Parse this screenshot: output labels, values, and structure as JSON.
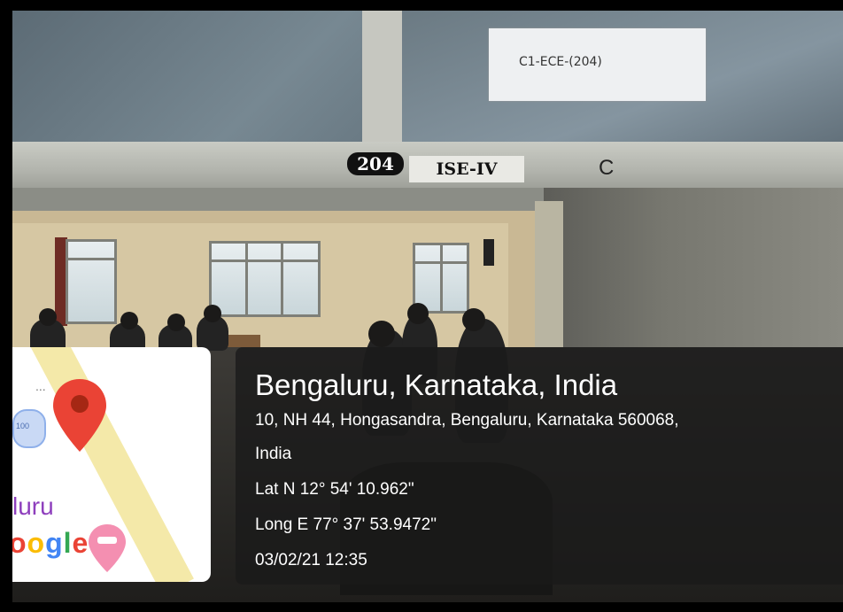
{
  "signs": {
    "room_number": "204",
    "room_name": "ISE-IV",
    "paper_label": "C1-ECE-(204)",
    "c_mark": "C"
  },
  "map_thumbnail": {
    "city_fragment": "luru",
    "logo_fragment": [
      "o",
      "o",
      "g",
      "l",
      "e"
    ],
    "bubble_text": "100",
    "dots": "...",
    "colors": {
      "pin": "#ea4335",
      "road": "#f4e9a9",
      "city_text": "#8e3fbd"
    }
  },
  "location": {
    "title": "Bengaluru, Karnataka, India",
    "address_line1": "10, NH 44, Hongasandra, Bengaluru, Karnataka 560068,",
    "address_line2": "India",
    "latitude": "Lat N 12° 54' 10.962\"",
    "longitude": "Long E 77° 37' 53.9472\"",
    "datetime": "03/02/21 12:35"
  }
}
